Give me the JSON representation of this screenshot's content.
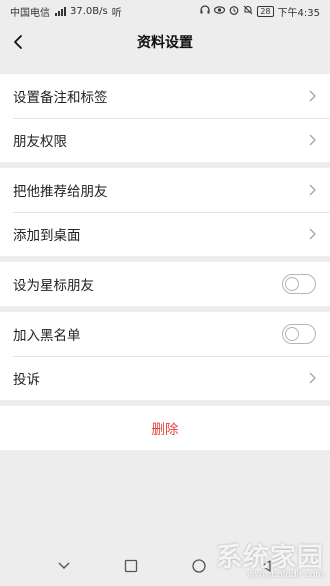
{
  "statusbar": {
    "carrier": "中国电信",
    "network_speed": "37.0B/s",
    "extra": "听",
    "battery": "28",
    "time": "下午4:35"
  },
  "header": {
    "title": "资料设置",
    "back_icon": "chevron-left-icon"
  },
  "groups": [
    {
      "items": [
        {
          "label": "设置备注和标签"
        },
        {
          "label": "朋友权限"
        }
      ]
    },
    {
      "items": [
        {
          "label": "把他推荐给朋友"
        },
        {
          "label": "添加到桌面"
        }
      ]
    },
    {
      "items": [
        {
          "label": "设为星标朋友",
          "toggle": false
        }
      ]
    },
    {
      "items": [
        {
          "label": "加入黑名单",
          "toggle": false
        },
        {
          "label": "投诉"
        }
      ]
    }
  ],
  "delete_label": "删除",
  "colors": {
    "background": "#ededed",
    "danger": "#e64340",
    "divider": "#e5e5e5"
  },
  "watermark": {
    "text": "系统家园",
    "url": "www.bolddir.com"
  }
}
